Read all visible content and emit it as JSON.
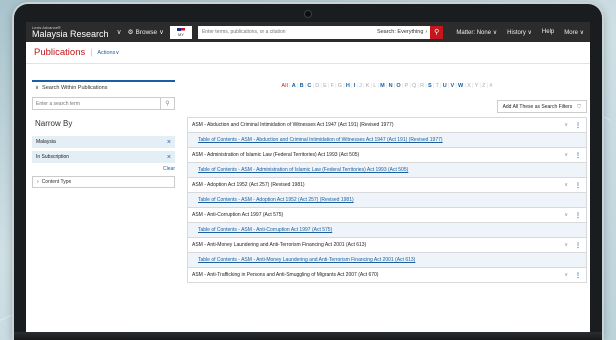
{
  "header": {
    "brand_sub": "Lexis Advance®",
    "brand_main": "Malaysia Research",
    "brand_caret": "∨",
    "browse_label": "Browse",
    "browse_caret": "∨",
    "jurisdiction": "MY",
    "search_placeholder": "Enter terms, publications, or a citation",
    "search_scope": "Search: Everything",
    "search_scope_caret": "›",
    "search_button": "⚲",
    "matter": "Matter: None",
    "history": "History",
    "help": "Help",
    "more": "More"
  },
  "subheader": {
    "title": "Publications",
    "separator": "|",
    "actions": "Actions"
  },
  "left": {
    "search_within": "Search Within Publications",
    "search_within_caret": "∨",
    "search_placeholder": "Enter a search term",
    "search_btn": "⚲",
    "narrow_by": "Narrow By",
    "filters": [
      {
        "label": "Malaysia",
        "remove": "×"
      },
      {
        "label": "In Subscription",
        "remove": "×"
      }
    ],
    "clear": "Clear",
    "content_type": "Content Type",
    "content_type_caret": "›"
  },
  "right": {
    "alphabet": [
      {
        "ch": "All",
        "state": "first"
      },
      {
        "ch": "A",
        "state": "act"
      },
      {
        "ch": "B",
        "state": "act"
      },
      {
        "ch": "C",
        "state": "act"
      },
      {
        "ch": "D",
        "state": ""
      },
      {
        "ch": "E",
        "state": ""
      },
      {
        "ch": "F",
        "state": ""
      },
      {
        "ch": "G",
        "state": ""
      },
      {
        "ch": "H",
        "state": "act"
      },
      {
        "ch": "I",
        "state": "act"
      },
      {
        "ch": "J",
        "state": ""
      },
      {
        "ch": "K",
        "state": ""
      },
      {
        "ch": "L",
        "state": ""
      },
      {
        "ch": "M",
        "state": "act"
      },
      {
        "ch": "N",
        "state": "act"
      },
      {
        "ch": "O",
        "state": "act"
      },
      {
        "ch": "P",
        "state": ""
      },
      {
        "ch": "Q",
        "state": ""
      },
      {
        "ch": "R",
        "state": ""
      },
      {
        "ch": "S",
        "state": "act"
      },
      {
        "ch": "T",
        "state": ""
      },
      {
        "ch": "U",
        "state": "act"
      },
      {
        "ch": "V",
        "state": "act"
      },
      {
        "ch": "W",
        "state": "act"
      },
      {
        "ch": "X",
        "state": ""
      },
      {
        "ch": "Y",
        "state": ""
      },
      {
        "ch": "Z",
        "state": ""
      },
      {
        "ch": "#",
        "state": ""
      }
    ],
    "add_all": "Add All These as Search Filters",
    "add_all_icon": "⛉",
    "items": [
      {
        "title": "ASM - Abduction and Criminal Intimidation of Witnesses Act 1947 (Act 191) (Revised 1977)",
        "toc": "Table of Contents - ASM - Abduction and Criminal Intimidation of Witnesses Act 1947 (Act 191) (Revised 1977)"
      },
      {
        "title": "ASM - Administration of Islamic Law (Federal Territories) Act 1993 (Act 505)",
        "toc": "Table of Contents - ASM - Administration of Islamic Law (Federal Territories) Act 1993 (Act 505)"
      },
      {
        "title": "ASM - Adoption Act 1952 (Act 257) (Revised 1981)",
        "toc": "Table of Contents - ASM - Adoption Act 1952 (Act 257) (Revised 1981)"
      },
      {
        "title": "ASM - Anti-Corruption Act 1997 (Act 575)",
        "toc": "Table of Contents - ASM - Anti-Corruption Act 1997 (Act 575)"
      },
      {
        "title": "ASM - Anti-Money Laundering and Anti-Terrorism Financing Act 2001 (Act 613)",
        "toc": "Table of Contents - ASM - Anti-Money Laundering and Anti-Terrorism Financing Act 2001 (Act 613)"
      },
      {
        "title": "ASM - Anti-Trafficking in Persons and Anti-Smuggling of Migrants Act 2007 (Act 670)",
        "toc": ""
      }
    ],
    "chevron": "∨",
    "more_icon": "⋮"
  }
}
